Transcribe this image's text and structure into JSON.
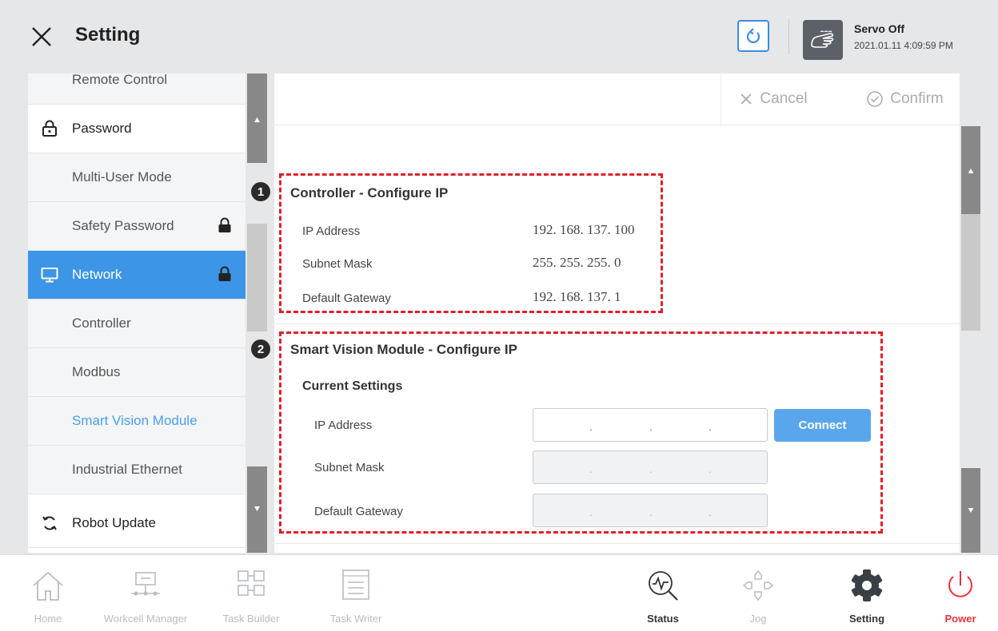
{
  "header": {
    "title": "Setting",
    "servo_status": "Servo Off",
    "datetime": "2021.01.11 4:09:59 PM"
  },
  "sidebar": {
    "items": [
      {
        "label": "Remote Control"
      },
      {
        "label": "Password"
      },
      {
        "label": "Multi-User Mode"
      },
      {
        "label": "Safety Password"
      },
      {
        "label": "Network"
      },
      {
        "label": "Controller"
      },
      {
        "label": "Modbus"
      },
      {
        "label": "Smart Vision Module"
      },
      {
        "label": "Industrial Ethernet"
      },
      {
        "label": "Robot Update"
      }
    ]
  },
  "actions": {
    "cancel": "Cancel",
    "confirm": "Confirm"
  },
  "controller": {
    "badge": "1",
    "title": "Controller - Configure IP",
    "rows": [
      {
        "label": "IP Address",
        "value": "192. 168. 137. 100"
      },
      {
        "label": "Subnet Mask",
        "value": "255. 255. 255. 0"
      },
      {
        "label": "Default Gateway",
        "value": "192. 168. 137. 1"
      }
    ]
  },
  "vision": {
    "badge": "2",
    "title": "Smart Vision Module - Configure IP",
    "subtitle": "Current Settings",
    "rows": [
      {
        "label": "IP Address"
      },
      {
        "label": "Subnet Mask"
      },
      {
        "label": "Default Gateway"
      }
    ],
    "connect": "Connect",
    "dot": "."
  },
  "nav": {
    "items": [
      {
        "label": "Home"
      },
      {
        "label": "Workcell Manager"
      },
      {
        "label": "Task Builder"
      },
      {
        "label": "Task Writer"
      },
      {
        "label": "Status"
      },
      {
        "label": "Jog"
      },
      {
        "label": "Setting"
      },
      {
        "label": "Power"
      }
    ]
  },
  "colors": {
    "accent": "#3c95e6",
    "highlight_border": "#e0202a",
    "power": "#e8323c"
  }
}
